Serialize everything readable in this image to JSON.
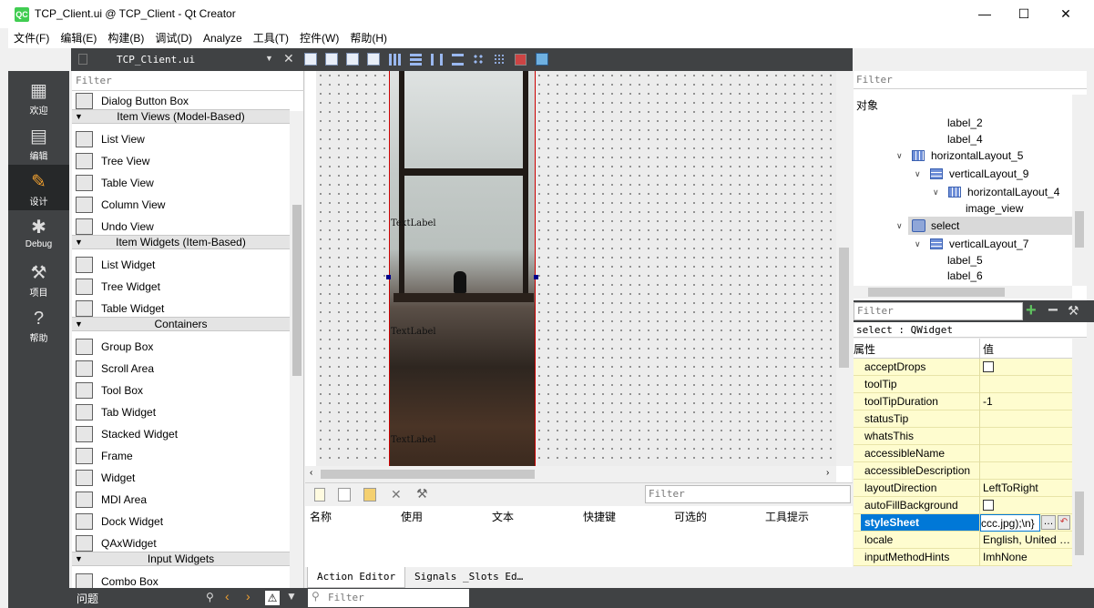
{
  "window": {
    "title": "TCP_Client.ui @ TCP_Client - Qt Creator",
    "app_icon": "QC",
    "minimize": "—",
    "maximize": "☐",
    "close": "✕"
  },
  "menu": [
    "文件(F)",
    "编辑(E)",
    "构建(B)",
    "调试(D)",
    "Analyze",
    "工具(T)",
    "控件(W)",
    "帮助(H)"
  ],
  "modes": [
    {
      "label": "欢迎",
      "icon": "grid-icon"
    },
    {
      "label": "编辑",
      "icon": "document-icon"
    },
    {
      "label": "设计",
      "icon": "pencil-icon"
    },
    {
      "label": "Debug",
      "icon": "bug-icon"
    },
    {
      "label": "项目",
      "icon": "wrench-icon"
    },
    {
      "label": "帮助",
      "icon": "help-icon"
    }
  ],
  "toolbar": {
    "file": "TCP_Client.ui"
  },
  "widgetbox": {
    "filter": "Filter",
    "items": [
      {
        "type": "item",
        "label": "Dialog Button Box"
      },
      {
        "type": "cat",
        "label": "Item Views (Model-Based)"
      },
      {
        "type": "item",
        "label": "List View"
      },
      {
        "type": "item",
        "label": "Tree View"
      },
      {
        "type": "item",
        "label": "Table View"
      },
      {
        "type": "item",
        "label": "Column View"
      },
      {
        "type": "item",
        "label": "Undo View"
      },
      {
        "type": "cat",
        "label": "Item Widgets (Item-Based)"
      },
      {
        "type": "item",
        "label": "List Widget"
      },
      {
        "type": "item",
        "label": "Tree Widget"
      },
      {
        "type": "item",
        "label": "Table Widget"
      },
      {
        "type": "cat",
        "label": "Containers"
      },
      {
        "type": "item",
        "label": "Group Box"
      },
      {
        "type": "item",
        "label": "Scroll Area"
      },
      {
        "type": "item",
        "label": "Tool Box"
      },
      {
        "type": "item",
        "label": "Tab Widget"
      },
      {
        "type": "item",
        "label": "Stacked Widget"
      },
      {
        "type": "item",
        "label": "Frame"
      },
      {
        "type": "item",
        "label": "Widget"
      },
      {
        "type": "item",
        "label": "MDI Area"
      },
      {
        "type": "item",
        "label": "Dock Widget"
      },
      {
        "type": "item",
        "label": "QAxWidget"
      },
      {
        "type": "cat",
        "label": "Input Widgets"
      },
      {
        "type": "item",
        "label": "Combo Box"
      }
    ]
  },
  "canvas": {
    "labels": [
      "TextLabel",
      "TextLabel",
      "TextLabel"
    ]
  },
  "action_editor": {
    "filter": "Filter",
    "columns": [
      "名称",
      "使用",
      "文本",
      "快捷键",
      "可选的",
      "工具提示"
    ],
    "tabs": [
      "Action Editor",
      "Signals _Slots Ed…"
    ]
  },
  "object_inspector": {
    "filter": "Filter",
    "header": "对象",
    "items": [
      "label_2",
      "label_4",
      "horizontalLayout_5",
      "verticalLayout_9",
      "horizontalLayout_4",
      "image_view",
      "select",
      "verticalLayout_7",
      "label_5",
      "label_6"
    ]
  },
  "property_editor": {
    "filter": "Filter",
    "title": "select : QWidget",
    "col_prop": "属性",
    "col_value": "值",
    "rows": [
      {
        "name": "acceptDrops",
        "value": ""
      },
      {
        "name": "toolTip",
        "value": ""
      },
      {
        "name": "toolTipDuration",
        "value": "-1"
      },
      {
        "name": "statusTip",
        "value": ""
      },
      {
        "name": "whatsThis",
        "value": ""
      },
      {
        "name": "accessibleName",
        "value": ""
      },
      {
        "name": "accessibleDescription",
        "value": ""
      },
      {
        "name": "layoutDirection",
        "value": "LeftToRight"
      },
      {
        "name": "autoFillBackground",
        "value": ""
      },
      {
        "name": "styleSheet",
        "value": "ccc.jpg);\\n}"
      },
      {
        "name": "locale",
        "value": "English, United …"
      },
      {
        "name": "inputMethodHints",
        "value": "ImhNone"
      }
    ]
  },
  "statusbar": {
    "issues": "问题",
    "filter": "Filter"
  }
}
